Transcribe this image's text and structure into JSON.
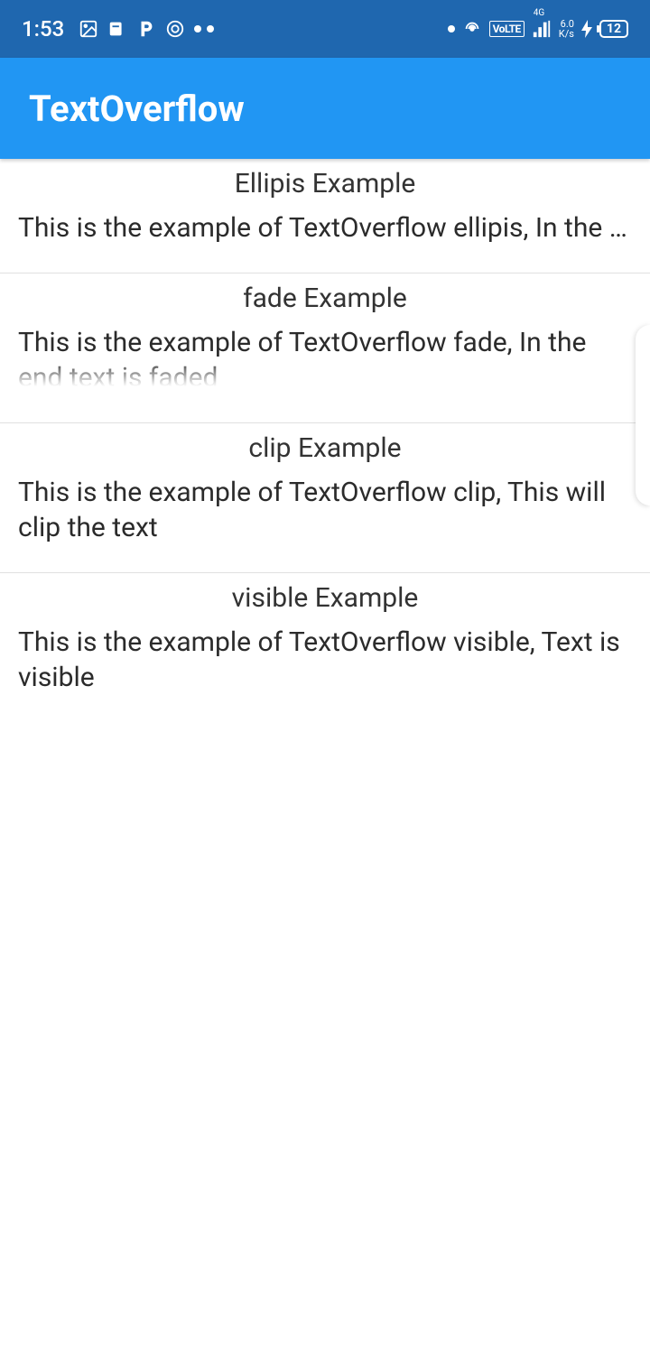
{
  "status_bar": {
    "time": "1:53",
    "volte": "VoLTE",
    "network_sup": "4G",
    "speed_top": "6.0",
    "speed_bottom": "K/s",
    "battery": "12"
  },
  "app_bar": {
    "title": "TextOverflow"
  },
  "sections": [
    {
      "title": "Ellipis Example",
      "body": "This is the example of TextOverflow ellipis, In the end there will be dots appended"
    },
    {
      "title": "fade Example",
      "body": "This is the example of TextOverflow fade, In the end text is faded"
    },
    {
      "title": "clip Example",
      "body": "This is the example of TextOverflow clip, This will clip the text"
    },
    {
      "title": "visible Example",
      "body": "This is the example of TextOverflow visible, Text is visible"
    }
  ]
}
